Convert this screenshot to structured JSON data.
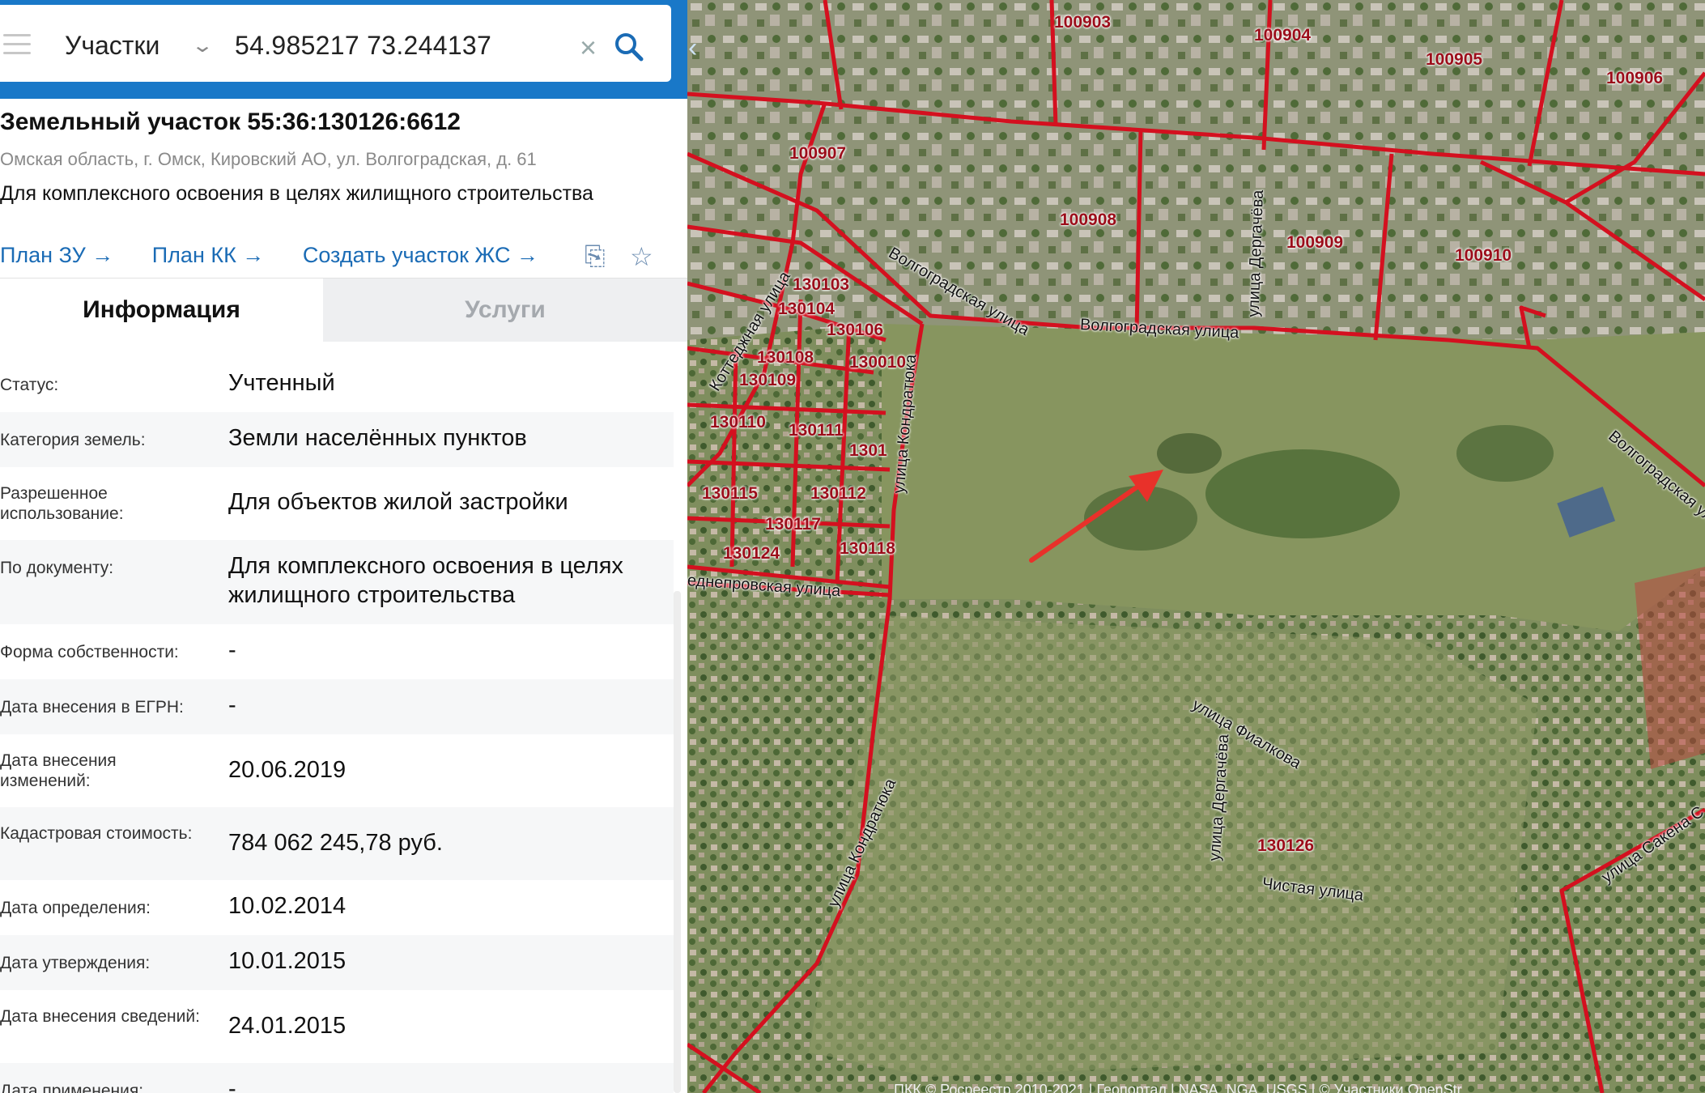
{
  "search": {
    "layer": "Участки",
    "query": "54.985217 73.244137"
  },
  "parcel": {
    "title": "Земельный участок 55:36:130126:6612",
    "address": "Омская область, г. Омск, Кировский АО, ул. Волгоградская, д. 61",
    "purpose": "Для комплексного освоения в целях жилищного строительства",
    "links": [
      "План ЗУ →",
      "План КК →",
      "Создать участок ЖС →"
    ]
  },
  "tabs": {
    "info": "Информация",
    "services": "Услуги"
  },
  "rows": [
    {
      "label": "Статус:",
      "value": "Учтенный"
    },
    {
      "label": "Категория земель:",
      "value": "Земли населённых пунктов"
    },
    {
      "label": "Разрешенное использование:",
      "value": "Для объектов жилой застройки"
    },
    {
      "label": "По документу:",
      "value": "Для комплексного освоения в целях жилищного строительства"
    },
    {
      "label": "Форма собственности:",
      "value": "-"
    },
    {
      "label": "Дата внесения в ЕГРН:",
      "value": "-"
    },
    {
      "label": "Дата внесения изменений:",
      "value": "20.06.2019"
    },
    {
      "label": "Кадастровая стоимость:",
      "value": "784 062 245,78 руб."
    },
    {
      "label": "Дата определения:",
      "value": "10.02.2014"
    },
    {
      "label": "Дата утверждения:",
      "value": "10.01.2015"
    },
    {
      "label": "Дата внесения сведений:",
      "value": "24.01.2015"
    },
    {
      "label": "Дата применения:",
      "value": "-"
    }
  ],
  "map": {
    "blocks": [
      "100903",
      "100904",
      "100905",
      "100906",
      "100907",
      "100908",
      "100909",
      "100910",
      "130103",
      "130104",
      "130106",
      "130108",
      "130010",
      "130109",
      "130110",
      "130111",
      "1301",
      "130115",
      "130112",
      "130117",
      "130118",
      "130124",
      "130126"
    ],
    "streets": [
      "Волгоградская улица",
      "Волгоградская улица",
      "улица Дергачёва",
      "Коттеджная улица",
      "улица Кондратюка",
      "еднепровская улица",
      "улица Фиалкова",
      "улица Дергачёва",
      "улица Кондратюка",
      "Чистая улица",
      "Волгоградская улица",
      "улица Сакена С"
    ],
    "attribution": "ПКК © Росреестр 2010-2021 | Геопортал | NASA, NGA, USGS | © Участники OpenStr"
  },
  "colors": {
    "accent": "#1978c8",
    "boundary": "#d4101f",
    "arrow": "#e8312a"
  }
}
